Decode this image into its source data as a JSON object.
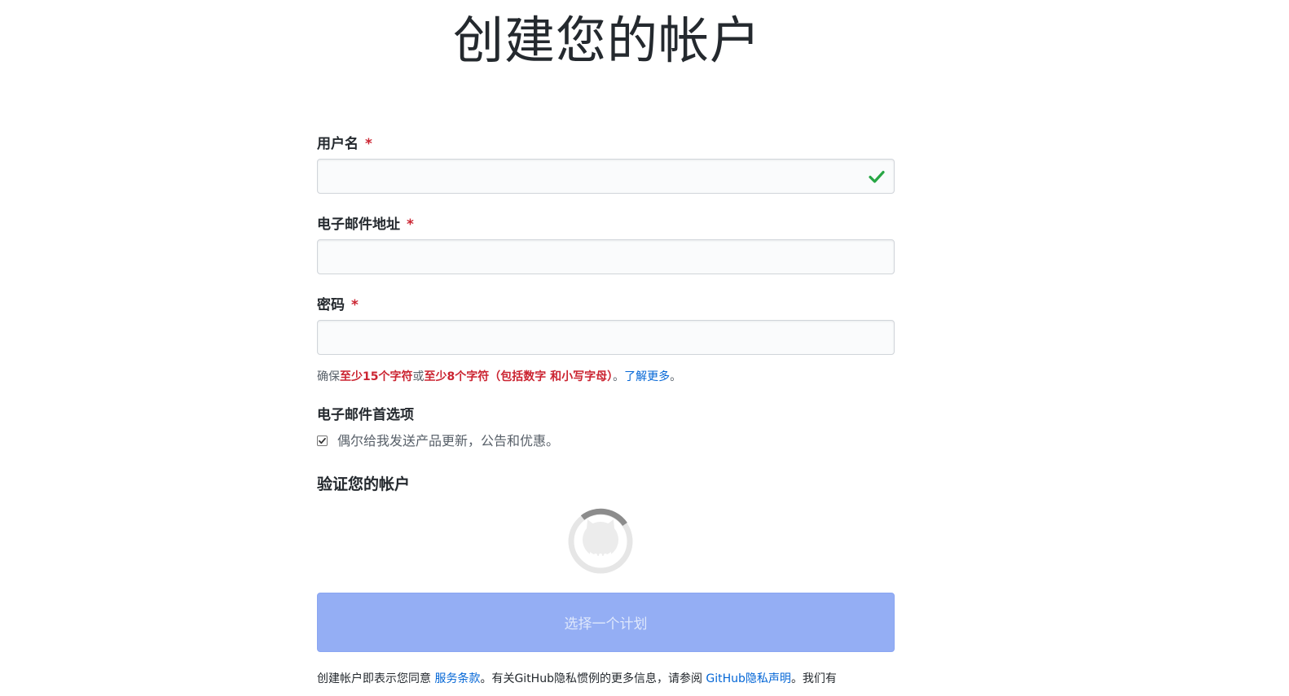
{
  "page": {
    "title": "创建您的帐户"
  },
  "form": {
    "username": {
      "label": "用户名",
      "required_mark": "*",
      "value": ""
    },
    "email": {
      "label": "电子邮件地址",
      "required_mark": "*",
      "value": ""
    },
    "password": {
      "label": "密码",
      "required_mark": "*",
      "value": ""
    },
    "password_hint": {
      "prefix": "确保",
      "rule_1": "至少15个字符",
      "or": "或",
      "rule_2": "至少8个字符（包括数字 和小写字母）",
      "suffix": "。",
      "learn_more": "了解更多",
      "end": "。"
    },
    "email_preferences": {
      "label": "电子邮件首选项",
      "checkbox_label": "偶尔给我发送产品更新，公告和优惠。",
      "checked": true
    },
    "verify": {
      "label": "验证您的帐户"
    },
    "submit_label": "选择一个计划",
    "terms": {
      "prefix": "创建帐户即表示您同意 ",
      "terms_link": "服务条款",
      "middle": "。有关GitHub隐私惯例的更多信息，请参阅 ",
      "privacy_link": "GitHub隐私声明",
      "suffix": "。我们有"
    }
  },
  "colors": {
    "required": "#cb2431",
    "link": "#0366d6",
    "success": "#28a745",
    "button_disabled": "#94aef4"
  },
  "icons": {
    "username_status": "checkmark-icon",
    "verify_loading": "github-octocat-spinner-icon"
  }
}
